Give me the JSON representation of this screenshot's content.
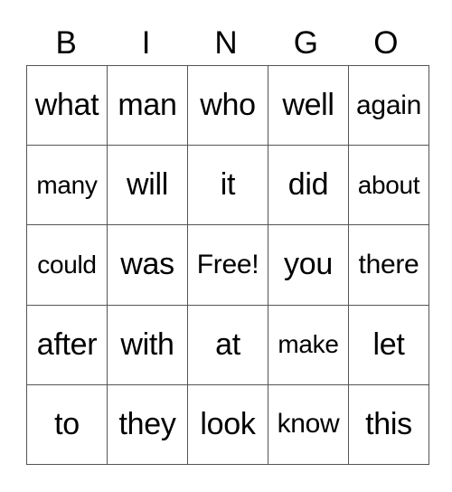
{
  "header": [
    "B",
    "I",
    "N",
    "G",
    "O"
  ],
  "grid": [
    [
      "what",
      "man",
      "who",
      "well",
      "again"
    ],
    [
      "many",
      "will",
      "it",
      "did",
      "about"
    ],
    [
      "could",
      "was",
      "Free!",
      "you",
      "there"
    ],
    [
      "after",
      "with",
      "at",
      "make",
      "let"
    ],
    [
      "to",
      "they",
      "look",
      "know",
      "this"
    ]
  ],
  "free_space": {
    "row": 2,
    "col": 2,
    "label": "Free!"
  }
}
